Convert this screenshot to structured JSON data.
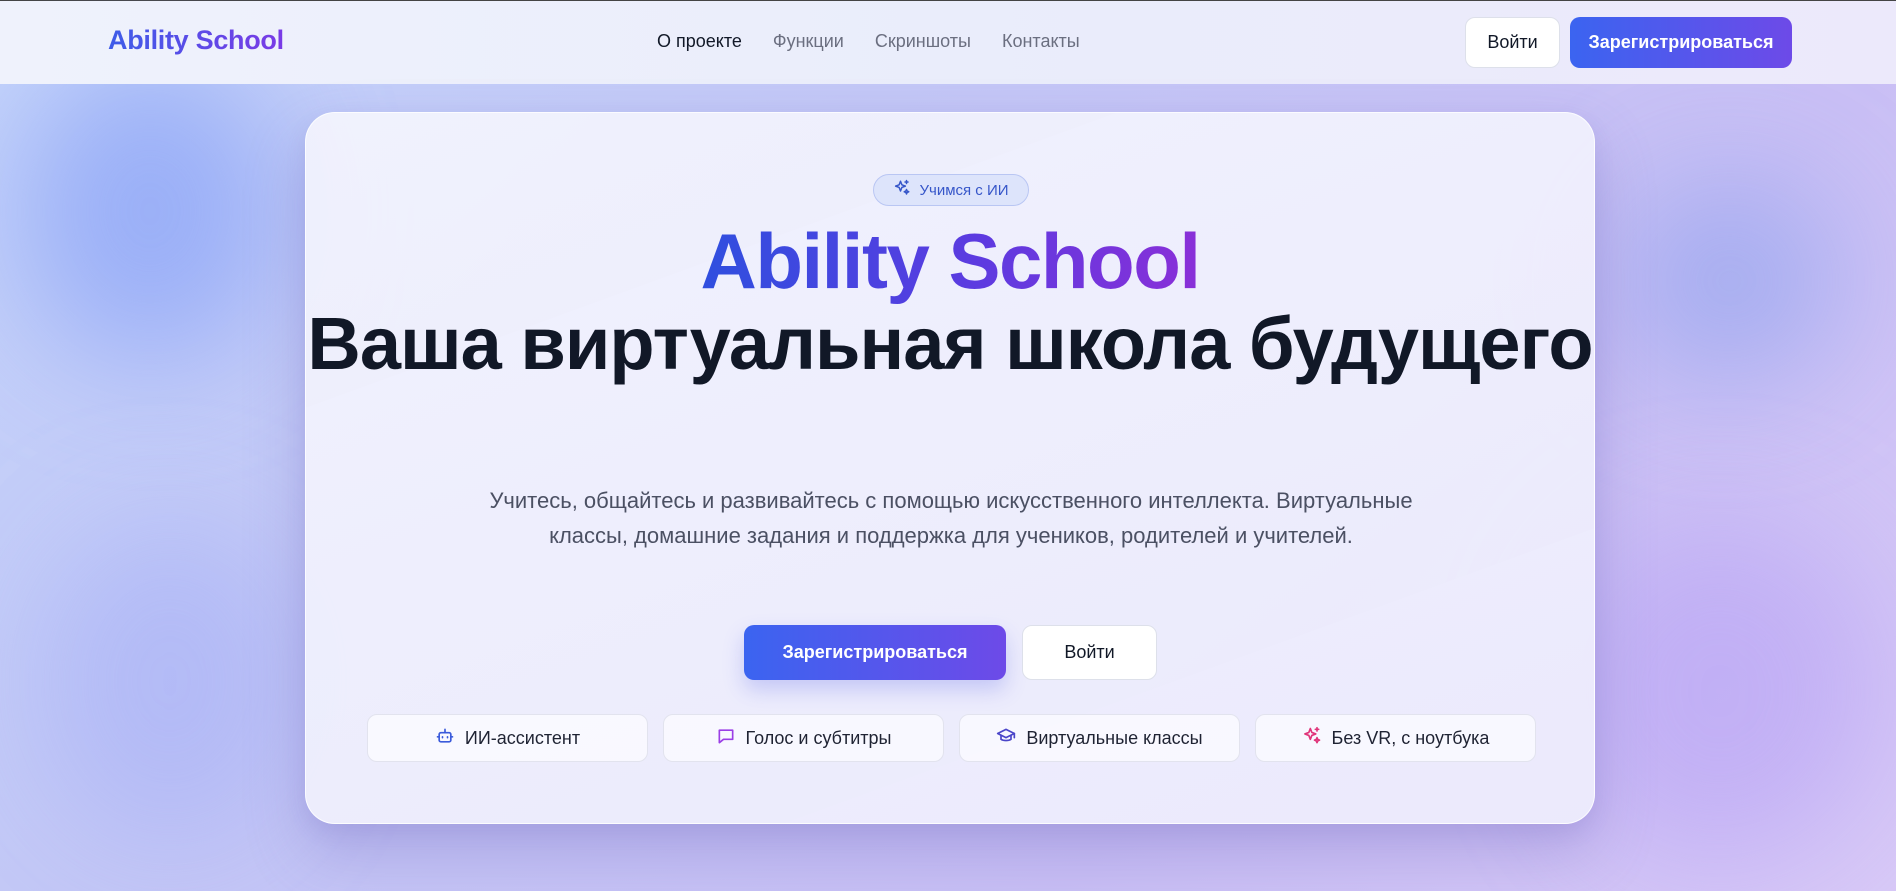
{
  "header": {
    "logo": "Ability School",
    "nav": [
      {
        "label": "О проекте",
        "active": true
      },
      {
        "label": "Функции",
        "active": false
      },
      {
        "label": "Скриншоты",
        "active": false
      },
      {
        "label": "Контакты",
        "active": false
      }
    ],
    "login_label": "Войти",
    "register_label": "Зарегистрироваться"
  },
  "hero": {
    "badge": {
      "icon": "sparkles-icon",
      "label": "Учимся с ИИ"
    },
    "brand": "Ability School",
    "title": "Ваша виртуальная школа будущего",
    "description": "Учитесь, общайтесь и развивайтесь с помощью искусственного интеллекта. Виртуальные классы, домашние задания и поддержка для учеников, родителей и учителей.",
    "register_label": "Зарегистрироваться",
    "login_label": "Войти",
    "features": [
      {
        "icon": "bot-icon",
        "label": "ИИ-ассистент",
        "color": "#3b5bdb"
      },
      {
        "icon": "message-icon",
        "label": "Голос и субтитры",
        "color": "#9b3fe6"
      },
      {
        "icon": "graduation-cap-icon",
        "label": "Виртуальные классы",
        "color": "#4a45c9"
      },
      {
        "icon": "sparkles-icon",
        "label": "Без VR, с ноутбука",
        "color": "#e0357a"
      }
    ]
  },
  "colors": {
    "accent_start": "#3b64f0",
    "accent_end": "#6d4ae8",
    "title": "#111827"
  }
}
